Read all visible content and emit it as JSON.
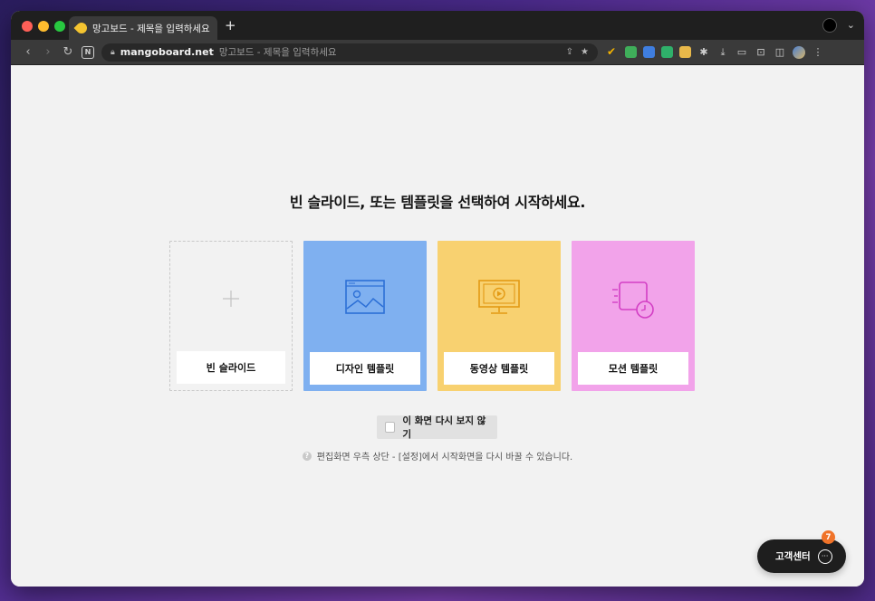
{
  "browser": {
    "tab_title": "망고보드 - 제목을 입력하세요",
    "new_tab_symbol": "+",
    "url_host": "mangoboard.net",
    "url_page_title": "망고보드 - 제목을 입력하세요",
    "nav": {
      "back": "‹",
      "forward": "›",
      "reload": "↻",
      "notion": "N"
    }
  },
  "page": {
    "headline": "빈 슬라이드, 또는 템플릿을 선택하여 시작하세요.",
    "cards": [
      {
        "label": "빈 슬라이드",
        "icon": "plus-icon",
        "color": "#f2f2f2"
      },
      {
        "label": "디자인 템플릿",
        "icon": "image-frame-icon",
        "color": "#7fb0f0"
      },
      {
        "label": "동영상 템플릿",
        "icon": "video-monitor-icon",
        "color": "#f8d170"
      },
      {
        "label": "모션 템플릿",
        "icon": "motion-clock-icon",
        "color": "#f2a3ea"
      }
    ],
    "dont_show_label": "이 화면 다시 보지 않기",
    "hint_icon": "?",
    "hint_text": "편집화면 우측 상단 - [설정]에서 시작화면을 다시 바꿀 수 있습니다."
  },
  "support": {
    "label": "고객센터",
    "badge": "7",
    "chat_symbol": "···"
  }
}
